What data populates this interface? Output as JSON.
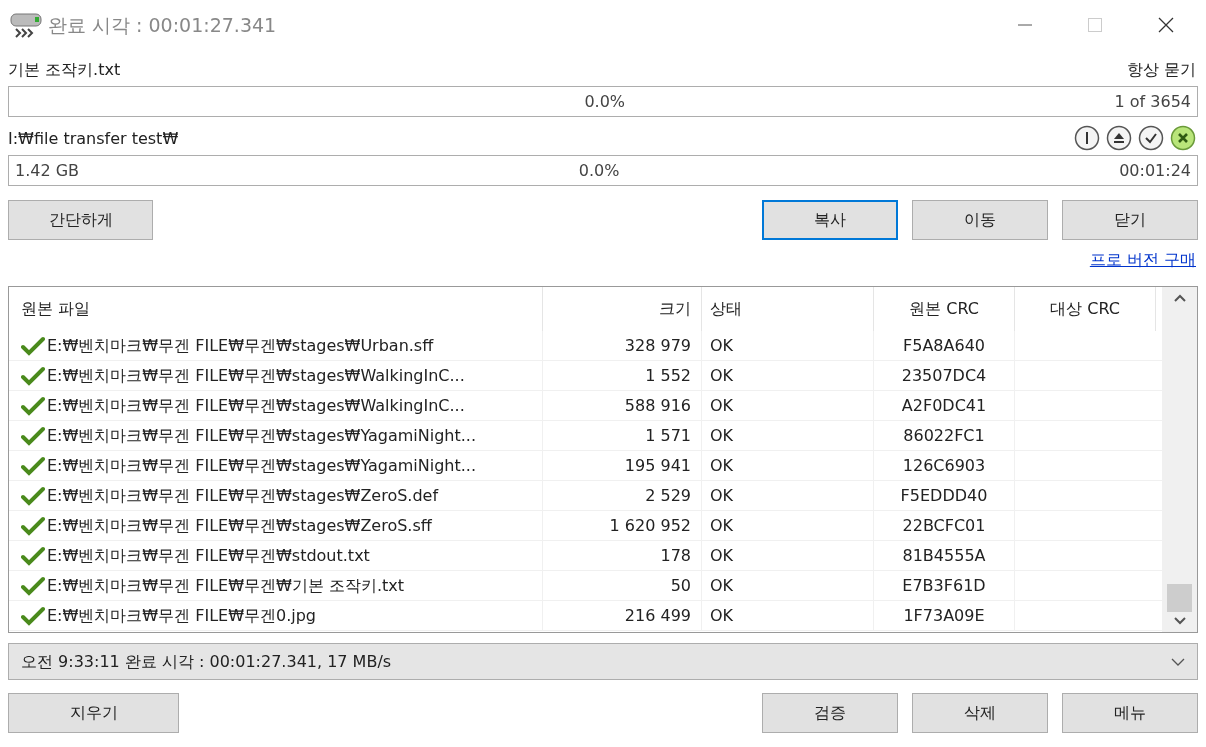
{
  "window": {
    "title": "완료 시각 : 00:01:27.341"
  },
  "current_file": {
    "name": "기본 조작키.txt",
    "mode": "항상 묻기",
    "level": 0,
    "percent": "0.0%",
    "count": "1 of 3654"
  },
  "destination": {
    "path": "I:₩file transfer test₩",
    "level": 0,
    "size": "1.42 GB",
    "percent": "0.0%",
    "time": "00:01:24"
  },
  "top_buttons": {
    "left": [
      {
        "label": "간단하게",
        "default": false
      }
    ],
    "right": [
      {
        "label": "복사",
        "default": true
      },
      {
        "label": "이동",
        "default": false
      },
      {
        "label": "닫기",
        "default": false
      }
    ]
  },
  "pro_link": "프로 버전 구매",
  "table": {
    "columns": [
      "원본 파일",
      "크기",
      "상태",
      "원본 CRC",
      "대상 CRC"
    ],
    "rows": [
      {
        "file": "E:₩벤치마크₩무겐 FILE₩무겐₩stages₩Urban.sff",
        "size": "328 979",
        "status": "OK",
        "src_crc": "F5A8A640",
        "ok": true
      },
      {
        "file": "E:₩벤치마크₩무겐 FILE₩무겐₩stages₩WalkingInC...",
        "size": "1 552",
        "status": "OK",
        "src_crc": "23507DC4",
        "ok": true
      },
      {
        "file": "E:₩벤치마크₩무겐 FILE₩무겐₩stages₩WalkingInC...",
        "size": "588 916",
        "status": "OK",
        "src_crc": "A2F0DC41",
        "ok": true
      },
      {
        "file": "E:₩벤치마크₩무겐 FILE₩무겐₩stages₩YagamiNight...",
        "size": "1 571",
        "status": "OK",
        "src_crc": "86022FC1",
        "ok": true
      },
      {
        "file": "E:₩벤치마크₩무겐 FILE₩무겐₩stages₩YagamiNight...",
        "size": "195 941",
        "status": "OK",
        "src_crc": "126C6903",
        "ok": true
      },
      {
        "file": "E:₩벤치마크₩무겐 FILE₩무겐₩stages₩ZeroS.def",
        "size": "2 529",
        "status": "OK",
        "src_crc": "F5EDDD40",
        "ok": true
      },
      {
        "file": "E:₩벤치마크₩무겐 FILE₩무겐₩stages₩ZeroS.sff",
        "size": "1 620 952",
        "status": "OK",
        "src_crc": "22BCFC01",
        "ok": true
      },
      {
        "file": "E:₩벤치마크₩무겐 FILE₩무겐₩stdout.txt",
        "size": "178",
        "status": "OK",
        "src_crc": "81B4555A",
        "ok": true
      },
      {
        "file": "E:₩벤치마크₩무겐 FILE₩무겐₩기본 조작키.txt",
        "size": "50",
        "status": "OK",
        "src_crc": "E7B3F61D",
        "ok": true
      },
      {
        "file": "E:₩벤치마크₩무겐 FILE₩무겐0.jpg",
        "size": "216 499",
        "status": "OK",
        "src_crc": "1F73A09E",
        "ok": true
      }
    ]
  },
  "status_bar": "오전 9:33:11 완료 시각 : 00:01:27.341, 17 MB/s",
  "bottom_buttons": {
    "left": [
      {
        "label": "지우기",
        "default": false
      }
    ],
    "right": [
      {
        "label": "검증",
        "default": false
      },
      {
        "label": "삭제",
        "default": false
      },
      {
        "label": "메뉴",
        "default": false
      }
    ]
  }
}
